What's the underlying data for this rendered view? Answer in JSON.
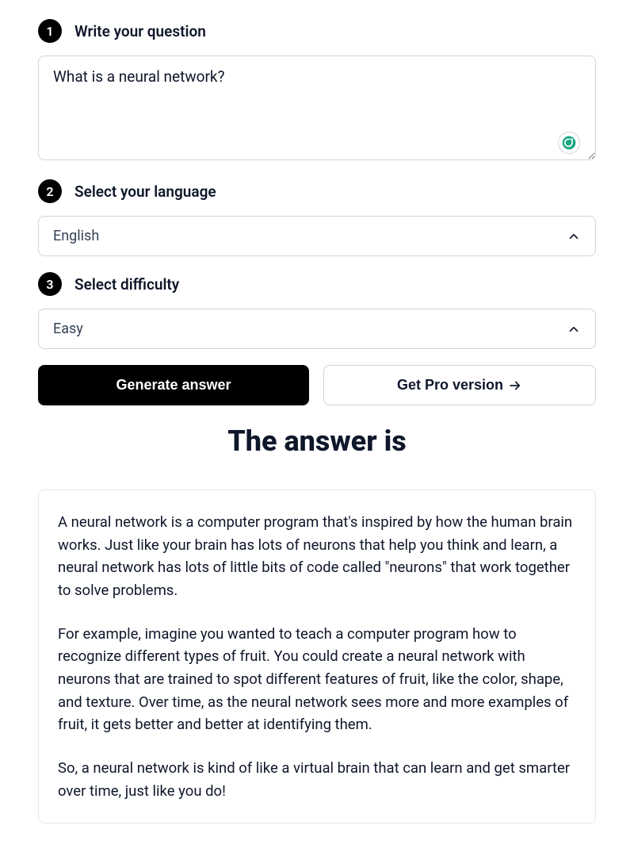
{
  "steps": {
    "one": {
      "num": "1",
      "label": "Write your question"
    },
    "two": {
      "num": "2",
      "label": "Select your language"
    },
    "three": {
      "num": "3",
      "label": "Select difficulty"
    }
  },
  "question": {
    "value": "What is a neural network?"
  },
  "language": {
    "selected": "English"
  },
  "difficulty": {
    "selected": "Easy"
  },
  "buttons": {
    "generate": "Generate answer",
    "pro": "Get Pro version"
  },
  "answer": {
    "heading": "The answer is",
    "paragraphs": [
      "A neural network is a computer program that's inspired by how the human brain works. Just like your brain has lots of neurons that help you think and learn, a neural network has lots of little bits of code called \"neurons\" that work together to solve problems.",
      "For example, imagine you wanted to teach a computer program how to recognize different types of fruit. You could create a neural network with neurons that are trained to spot different features of fruit, like the color, shape, and texture. Over time, as the neural network sees more and more examples of fruit, it gets better and better at identifying them.",
      "So, a neural network is kind of like a virtual brain that can learn and get smarter over time, just like you do!"
    ]
  }
}
